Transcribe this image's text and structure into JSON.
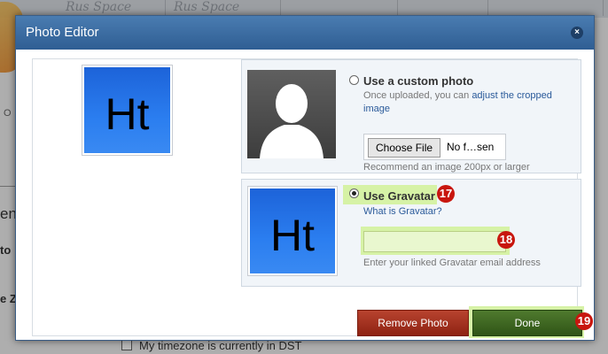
{
  "background": {
    "header_cells": [
      "Rus Space",
      "Rus Space"
    ],
    "frag_1": "O",
    "frag_2": "en",
    "frag_3": "to",
    "frag_4": "e Z",
    "dst_label": "My timezone is currently in DST"
  },
  "dialog": {
    "title": "Photo Editor",
    "close_icon": "×",
    "preview_logo_text": "Ht",
    "custom": {
      "title": "Use a custom photo",
      "desc_prefix": "Once uploaded, you can ",
      "desc_link": "adjust the cropped image",
      "choose_file_label": "Choose File",
      "file_status": "No f…sen",
      "recommend": "Recommend an image 200px or larger"
    },
    "gravatar": {
      "title": "Use Gravatar",
      "what_link": "What is Gravatar?",
      "email_value": "",
      "email_hint": "Enter your linked Gravatar email address",
      "logo_text": "Ht"
    },
    "buttons": {
      "remove": "Remove Photo",
      "done": "Done"
    },
    "badges": [
      "17",
      "18",
      "19"
    ]
  },
  "colors": {
    "titlebar": "#3b6ea5",
    "badge": "#c8160e",
    "highlight": "#d6f2a6",
    "remove_button": "#a0321e",
    "done_button": "#3e6622"
  },
  "icons": [
    "close-icon",
    "person-silhouette-icon",
    "ht-logo-icon"
  ]
}
